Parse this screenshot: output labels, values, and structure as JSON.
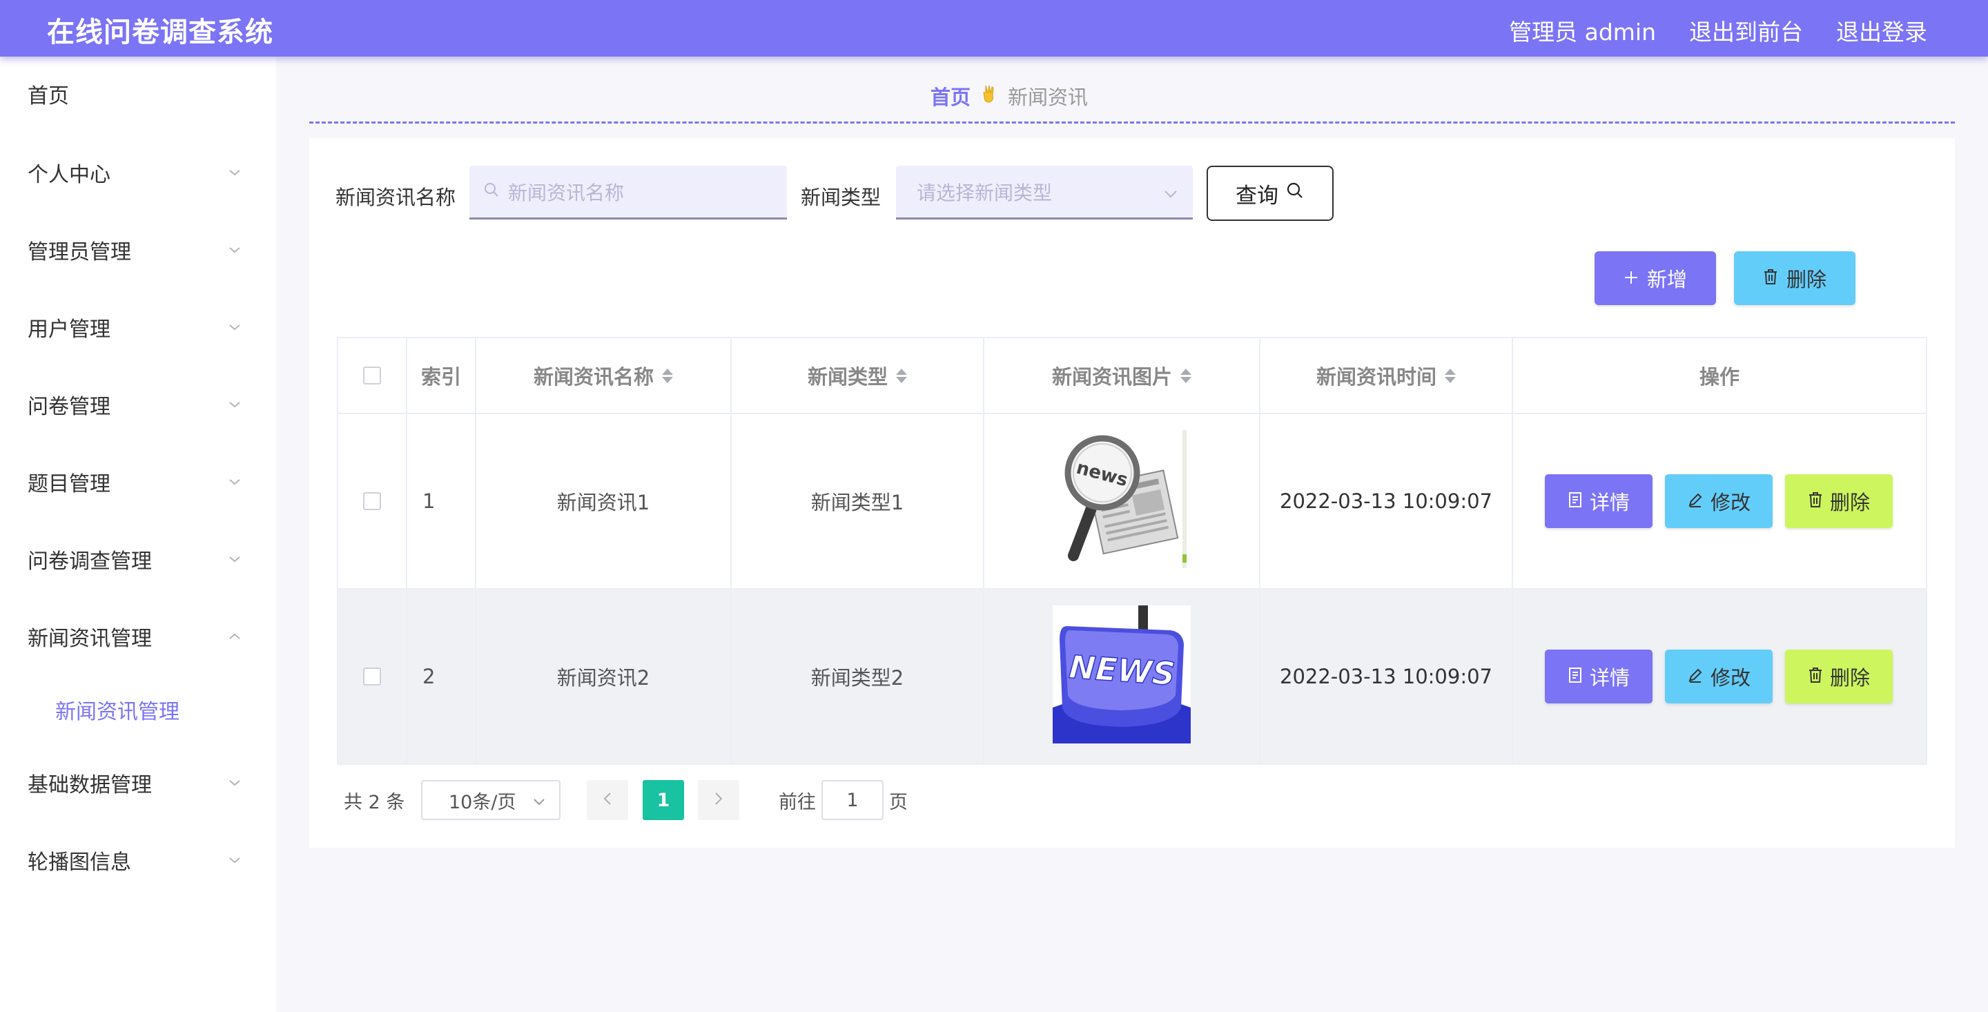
{
  "header": {
    "title": "在线问卷调查系统",
    "user": "管理员 admin",
    "to_front": "退出到前台",
    "logout": "退出登录"
  },
  "sidebar": {
    "items": [
      {
        "label": "首页",
        "chevron": ""
      },
      {
        "label": "个人中心",
        "chevron": "down"
      },
      {
        "label": "管理员管理",
        "chevron": "down"
      },
      {
        "label": "用户管理",
        "chevron": "down"
      },
      {
        "label": "问卷管理",
        "chevron": "down"
      },
      {
        "label": "题目管理",
        "chevron": "down"
      },
      {
        "label": "问卷调查管理",
        "chevron": "down"
      },
      {
        "label": "新闻资讯管理",
        "chevron": "up"
      },
      {
        "label": "基础数据管理",
        "chevron": "down"
      },
      {
        "label": "轮播图信息",
        "chevron": "down"
      }
    ],
    "submenu_active": "新闻资讯管理"
  },
  "breadcrumb": {
    "home": "首页",
    "separator_icon": "victory-hand-icon",
    "current": "新闻资讯"
  },
  "search": {
    "name_label": "新闻资讯名称",
    "name_placeholder": "新闻资讯名称",
    "type_label": "新闻类型",
    "type_placeholder": "请选择新闻类型",
    "query_button": "查询"
  },
  "actions": {
    "add": "新增",
    "delete": "删除"
  },
  "table": {
    "columns": [
      "索引",
      "新闻资讯名称",
      "新闻类型",
      "新闻资讯图片",
      "新闻资讯时间",
      "操作"
    ],
    "rows": [
      {
        "index": "1",
        "name": "新闻资讯1",
        "type": "新闻类型1",
        "image_label": "news",
        "image_icon": "magnifier-newspaper-icon",
        "time": "2022-03-13 10:09:07"
      },
      {
        "index": "2",
        "name": "新闻资讯2",
        "type": "新闻类型2",
        "image_label": "NEWS",
        "image_icon": "news-key-icon",
        "time": "2022-03-13 10:09:07"
      }
    ],
    "row_buttons": {
      "detail": "详情",
      "edit": "修改",
      "delete": "删除"
    }
  },
  "pagination": {
    "total": "共 2 条",
    "page_size": "10条/页",
    "current_page": "1",
    "goto_prefix": "前往",
    "goto_value": "1",
    "goto_suffix": "页"
  },
  "colors": {
    "primary": "#7b74f5",
    "info": "#63cdfa",
    "danger_lime": "#cdf55e",
    "pager_active": "#19c2a0"
  }
}
